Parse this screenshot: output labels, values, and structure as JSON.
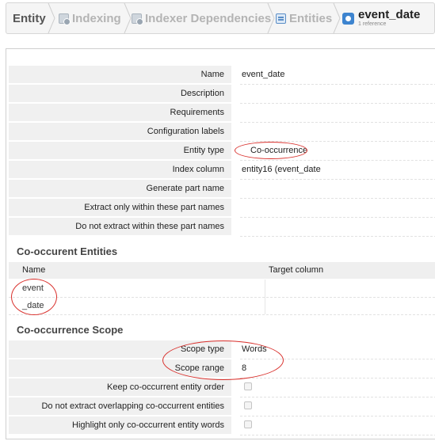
{
  "breadcrumb": {
    "entity": "Entity",
    "indexing": "Indexing",
    "indexer_dependencies": "Indexer Dependencies",
    "entities": "Entities",
    "current": "event_date",
    "current_sub": "1 reference"
  },
  "properties": [
    {
      "label": "Name",
      "value": "event_date"
    },
    {
      "label": "Description",
      "value": ""
    },
    {
      "label": "Requirements",
      "value": ""
    },
    {
      "label": "Configuration labels",
      "value": ""
    },
    {
      "label": "Entity type",
      "value": "Co-occurrence"
    },
    {
      "label": "Index column",
      "value": "entity16 (event_date"
    },
    {
      "label": "Generate part name",
      "value": ""
    },
    {
      "label": "Extract only within these part names",
      "value": ""
    },
    {
      "label": "Do not extract within these part names",
      "value": ""
    }
  ],
  "cooccurent": {
    "title": "Co-occurent Entities",
    "col_name": "Name",
    "col_target": "Target column",
    "rows": [
      {
        "name": "event",
        "target": ""
      },
      {
        "name": "_date",
        "target": ""
      }
    ]
  },
  "scope": {
    "title": "Co-occurrence Scope",
    "rows": [
      {
        "label": "Scope type",
        "value": "Words"
      },
      {
        "label": "Scope range",
        "value": "8"
      }
    ],
    "checks": [
      {
        "label": "Keep co-occurrent entity order",
        "checked": false
      },
      {
        "label": "Do not extract overlapping co-occurrent entities",
        "checked": false
      },
      {
        "label": "Highlight only co-occurrent entity words",
        "checked": false
      }
    ]
  },
  "colors": {
    "annotation": "#d9302c",
    "label_bg": "#f0f0f0",
    "breadcrumb_bg": "#f5f5f5"
  }
}
